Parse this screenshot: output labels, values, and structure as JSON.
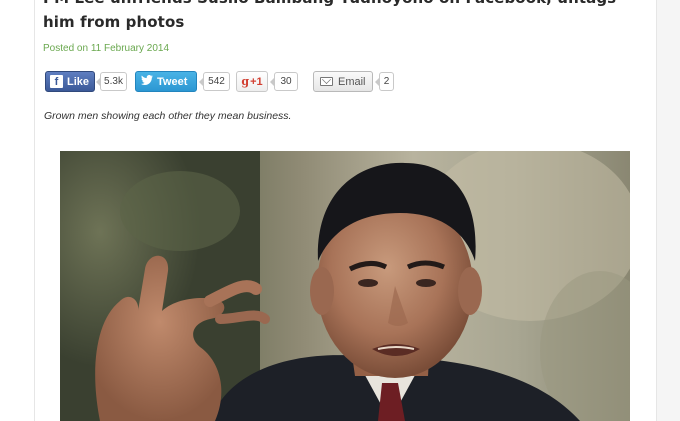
{
  "article": {
    "title": "PM Lee unfriends Susilo Bambang Yudhoyono on Facebook, untags him from photos",
    "posted_prefix": "Posted on",
    "posted_date": "11 February 2014",
    "caption": "Grown men showing each other they mean business."
  },
  "share": {
    "facebook": {
      "label": "Like",
      "count": "5.3k",
      "icon": "f"
    },
    "twitter": {
      "label": "Tweet",
      "count": "542"
    },
    "googleplus": {
      "label": "+1",
      "count": "30",
      "icon": "g"
    },
    "email": {
      "label": "Email",
      "count": "2"
    }
  },
  "photo": {
    "subject": "man in dark suit gesturing with raised hand"
  },
  "colors": {
    "posted_green": "#6aa84f",
    "facebook_blue": "#3b5998",
    "twitter_blue": "#2c97d3",
    "gplus_red": "#d23f31"
  }
}
